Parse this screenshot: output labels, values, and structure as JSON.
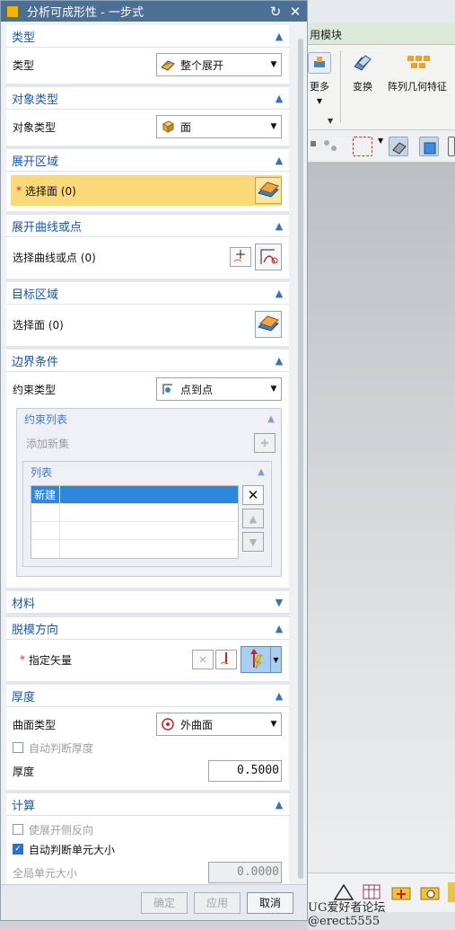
{
  "dialog": {
    "title": "分析可成形性 - 一步式",
    "reset_icon": "reset-icon",
    "close_icon": "close-icon"
  },
  "sections": {
    "type": {
      "header": "类型",
      "label": "类型",
      "value": "整个展开",
      "icon": "unfold-whole-icon"
    },
    "object_type": {
      "header": "对象类型",
      "label": "对象类型",
      "value": "面",
      "icon": "face-cube-icon"
    },
    "unfold_region": {
      "header": "展开区域",
      "select_label": "选择面 (0)",
      "required": "*"
    },
    "unfold_curve": {
      "header": "展开曲线或点",
      "label": "选择曲线或点 (0)"
    },
    "target_region": {
      "header": "目标区域",
      "label": "选择面 (0)"
    },
    "boundary": {
      "header": "边界条件",
      "constraint_label": "约束类型",
      "constraint_value": "点到点",
      "constraint_list": {
        "header": "约束列表",
        "add_new_set": "添加新集",
        "list": {
          "header": "列表",
          "rows": [
            "新建",
            "",
            "",
            ""
          ]
        }
      }
    },
    "material": {
      "header": "材料"
    },
    "draft": {
      "header": "脱模方向",
      "label": "指定矢量",
      "required": "*"
    },
    "thickness": {
      "header": "厚度",
      "surface_type_label": "曲面类型",
      "surface_type_value": "外曲面",
      "auto_thickness": "自动判断厚度",
      "thickness_label": "厚度",
      "thickness_value": "0.5000"
    },
    "compute": {
      "header": "计算",
      "use_unfold_reverse": "使展开侧反向",
      "auto_element_size": "自动判断单元大小",
      "global_element_label": "全局单元大小",
      "global_element_value": "0.0000"
    }
  },
  "footer": {
    "ok": "确定",
    "apply": "应用",
    "cancel": "取消"
  },
  "background": {
    "menu_label": "用模块",
    "ribbon": [
      {
        "label": "更多",
        "icon": "more-icon"
      },
      {
        "label": "变换",
        "icon": "transform-icon"
      },
      {
        "label": "阵列几何特征",
        "icon": "pattern-geometry-icon"
      }
    ],
    "watermark": "UG爱好者论坛@erect5555"
  }
}
